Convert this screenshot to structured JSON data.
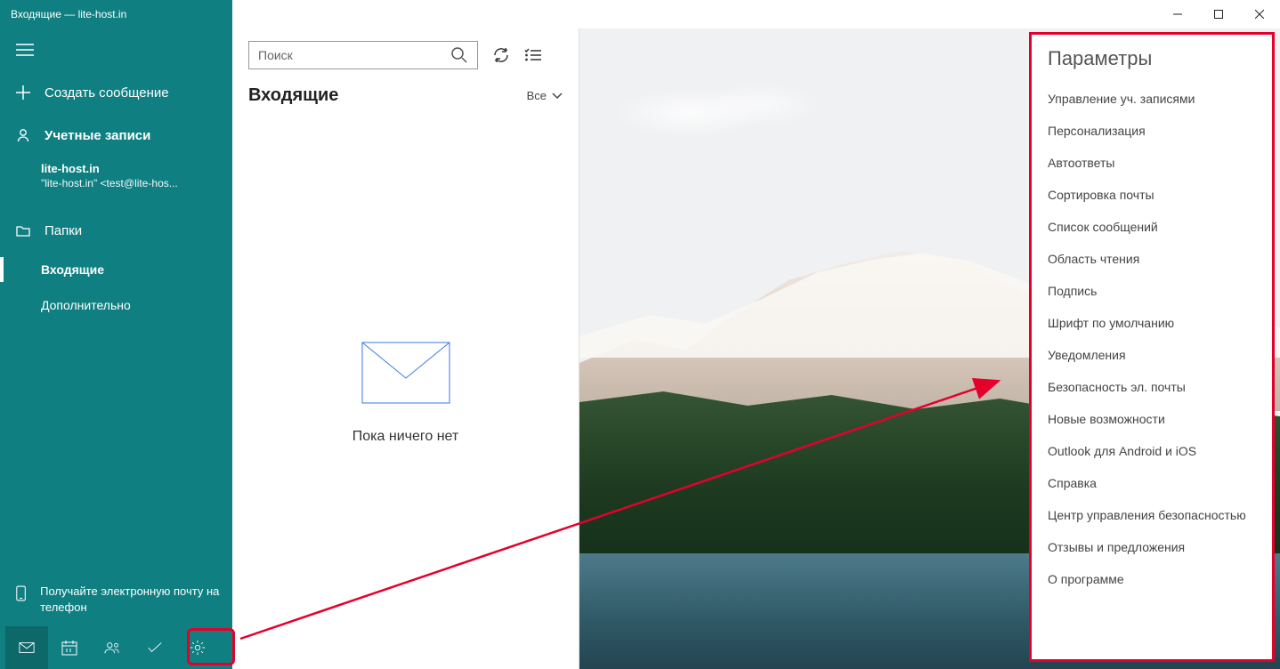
{
  "titlebar": {
    "title": "Входящие — lite-host.in"
  },
  "sidebar": {
    "compose_label": "Создать сообщение",
    "accounts_label": "Учетные записи",
    "account": {
      "name": "lite-host.in",
      "email": "\"lite-host.in\" <test@lite-hos..."
    },
    "folders_label": "Папки",
    "folder_inbox": "Входящие",
    "folder_more": "Дополнительно",
    "phone_promo": "Получайте электронную почту на телефон"
  },
  "list": {
    "search_placeholder": "Поиск",
    "heading": "Входящие",
    "filter": "Все",
    "empty_text": "Пока ничего нет"
  },
  "settings": {
    "title": "Параметры",
    "items": [
      "Управление уч. записями",
      "Персонализация",
      "Автоответы",
      "Сортировка почты",
      "Список сообщений",
      "Область чтения",
      "Подпись",
      "Шрифт по умолчанию",
      "Уведомления",
      "Безопасность эл. почты",
      "Новые возможности",
      "Outlook для Android и iOS",
      "Справка",
      "Центр управления безопасностью",
      "Отзывы и предложения",
      "О программе"
    ]
  }
}
